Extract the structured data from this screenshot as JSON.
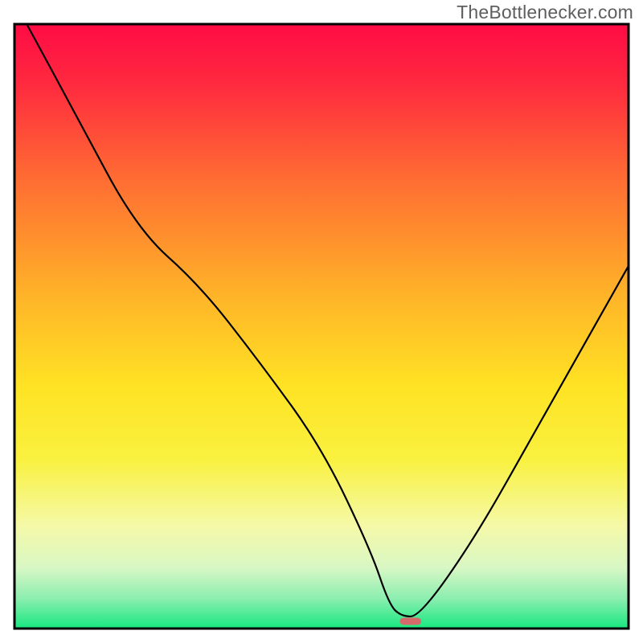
{
  "watermark": "TheBottlenecker.com",
  "chart_data": {
    "type": "line",
    "title": "",
    "xlabel": "",
    "ylabel": "",
    "xlim": [
      0,
      100
    ],
    "ylim": [
      0,
      100
    ],
    "grid": false,
    "legend": false,
    "series": [
      {
        "name": "bottleneck-curve",
        "x": [
          2,
          10,
          20,
          30,
          40,
          50,
          58,
          61,
          63,
          66,
          75,
          85,
          100
        ],
        "y": [
          100,
          85,
          66,
          57,
          44,
          30,
          13,
          4,
          2,
          2,
          15,
          33,
          60
        ]
      }
    ],
    "marker": {
      "name": "optimal-marker",
      "x": 64.5,
      "y": 1.2,
      "color": "#d46a6a",
      "width_frac": 0.035,
      "height_frac": 0.012
    },
    "background": {
      "type": "vertical-gradient",
      "stops": [
        {
          "offset": 0.0,
          "color": "#ff0b45"
        },
        {
          "offset": 0.1,
          "color": "#ff2a3f"
        },
        {
          "offset": 0.25,
          "color": "#ff6a33"
        },
        {
          "offset": 0.45,
          "color": "#ffb428"
        },
        {
          "offset": 0.6,
          "color": "#ffe324"
        },
        {
          "offset": 0.72,
          "color": "#f9f13f"
        },
        {
          "offset": 0.83,
          "color": "#f5f9a8"
        },
        {
          "offset": 0.9,
          "color": "#d8f7c4"
        },
        {
          "offset": 0.95,
          "color": "#8ceeb0"
        },
        {
          "offset": 1.0,
          "color": "#17e880"
        }
      ]
    },
    "frame_color": "#000000",
    "frame_width": 3,
    "line_color": "#000000",
    "line_width": 2.2
  }
}
